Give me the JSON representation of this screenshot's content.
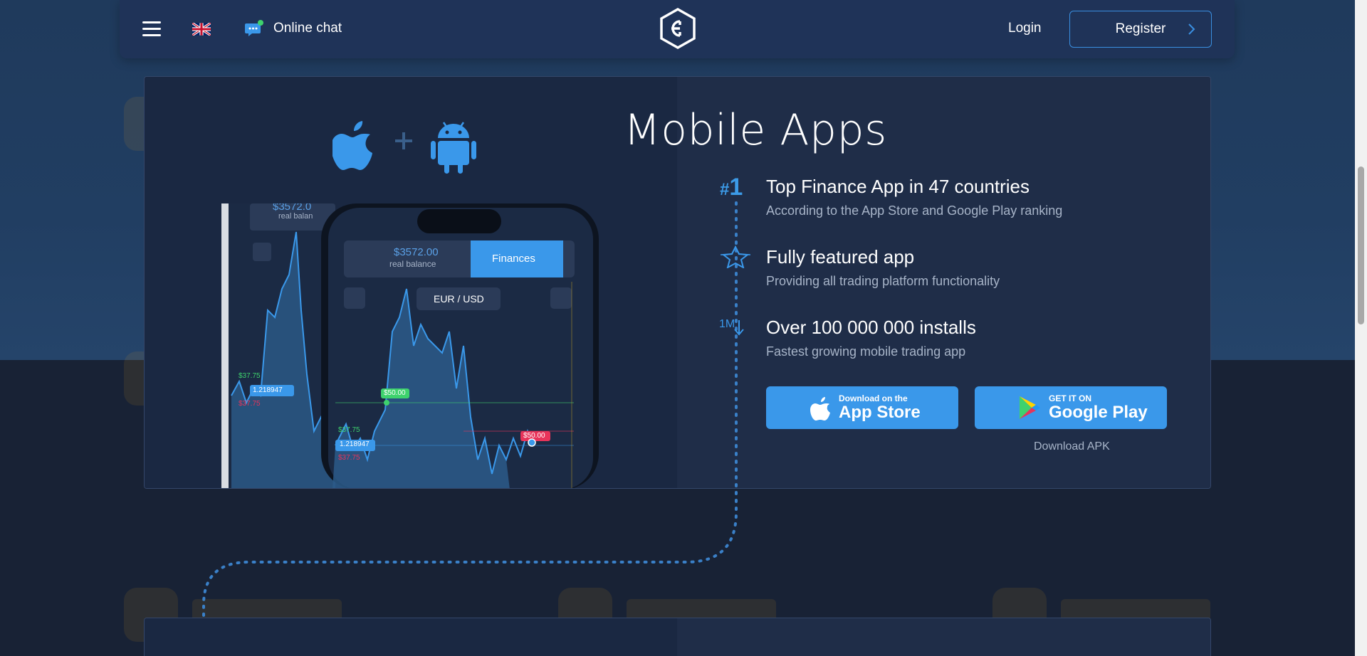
{
  "header": {
    "online_chat_label": "Online chat",
    "login_label": "Login",
    "register_label": "Register",
    "language_flag": "uk-flag-icon"
  },
  "hero": {
    "title": "Mobile Apps",
    "features": [
      {
        "badge": "#1",
        "icon": "number-one-icon",
        "title": "Top Finance App in 47 countries",
        "subtitle": "According to the App Store and Google Play ranking"
      },
      {
        "icon": "star-icon",
        "title": "Fully featured app",
        "subtitle": "Providing all trading platform functionality"
      },
      {
        "badge": "1M",
        "icon": "installs-icon",
        "title": "Over 100 000 000 installs",
        "subtitle": "Fastest growing mobile trading app"
      }
    ],
    "app_store": {
      "small": "Download on the",
      "big": "App Store"
    },
    "google_play": {
      "small": "GET IT ON",
      "big": "Google Play"
    },
    "download_apk_label": "Download APK"
  },
  "phone": {
    "balance": "$3572.00",
    "balance_label": "real balance",
    "back_balance": "$3572.0",
    "back_balance_label": "real balan",
    "finances_tab": "Finances",
    "pair": "EUR / USD",
    "tag_green": "$50.00",
    "tag_red": "$50.00",
    "level_price": "1.218947",
    "price_up": "$37.75",
    "price_down": "$37.75"
  },
  "colors": {
    "accent": "#3a98ea",
    "header_bg": "#1f3358",
    "panel_left": "#1a2842",
    "panel_right": "#1f2d48"
  }
}
